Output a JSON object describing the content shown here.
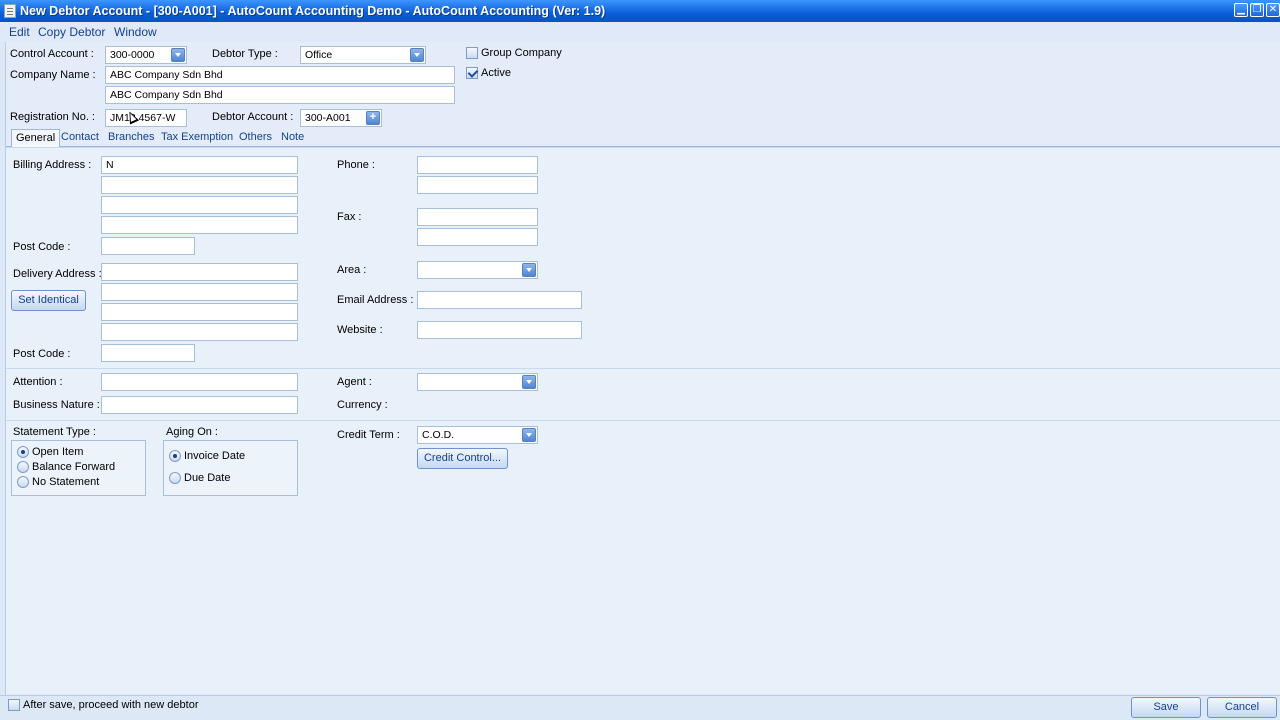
{
  "window": {
    "title": "New Debtor Account - [300-A001] - AutoCount Accounting Demo - AutoCount Accounting (Ver: 1.9)"
  },
  "menu": [
    "Edit",
    "Copy Debtor",
    "Window"
  ],
  "header": {
    "control_account_label": "Control Account :",
    "control_account_value": "300-0000",
    "debtor_type_label": "Debtor Type :",
    "debtor_type_value": "Office",
    "group_company_label": "Group Company",
    "group_company_checked": false,
    "active_label": "Active",
    "active_checked": true,
    "company_name_label": "Company Name :",
    "company_name_value": "ABC Company Sdn Bhd",
    "company_name_2_value": "ABC Company Sdn Bhd",
    "registration_label": "Registration No. :",
    "registration_value": "JM12 4567-W",
    "debtor_account_label": "Debtor Account :",
    "debtor_account_value": "300-A001"
  },
  "tabs": [
    "General",
    "Contact",
    "Branches",
    "Tax Exemption",
    "Others",
    "Note"
  ],
  "active_tab": "General",
  "general": {
    "billing_address_label": "Billing Address :",
    "billing_address_lines": [
      "N",
      "",
      "",
      ""
    ],
    "post_code_label": "Post Code :",
    "billing_post_code": "",
    "delivery_address_label": "Delivery Address :",
    "delivery_address_lines": [
      "",
      "",
      "",
      ""
    ],
    "set_identical_label": "Set Identical",
    "delivery_post_code_label": "Post Code :",
    "delivery_post_code": "",
    "phone_label": "Phone :",
    "phone_values": [
      "",
      ""
    ],
    "fax_label": "Fax :",
    "fax_values": [
      "",
      ""
    ],
    "area_label": "Area :",
    "area_value": "",
    "email_label": "Email  Address :",
    "email_value": "",
    "website_label": "Website :",
    "website_value": "",
    "attention_label": "Attention :",
    "attention_value": "",
    "business_nature_label": "Business Nature :",
    "business_nature_value": "",
    "agent_label": "Agent :",
    "agent_value": "",
    "currency_label": "Currency :",
    "statement_type_label": "Statement Type :",
    "statement_options": [
      "Open Item",
      "Balance Forward",
      "No Statement"
    ],
    "statement_selected": "Open Item",
    "aging_on_label": "Aging On :",
    "aging_options": [
      "Invoice Date",
      "Due Date"
    ],
    "aging_selected": "Invoice Date",
    "credit_term_label": "Credit Term :",
    "credit_term_value": "C.O.D.",
    "credit_control_label": "Credit Control..."
  },
  "footer": {
    "proceed_label": "After save, proceed with new debtor",
    "proceed_checked": false,
    "save_label": "Save",
    "cancel_label": "Cancel"
  },
  "colors": {
    "titlebar": "#0a5fd8",
    "form_bg": "#e3ecf8",
    "link_text": "#15428b"
  }
}
